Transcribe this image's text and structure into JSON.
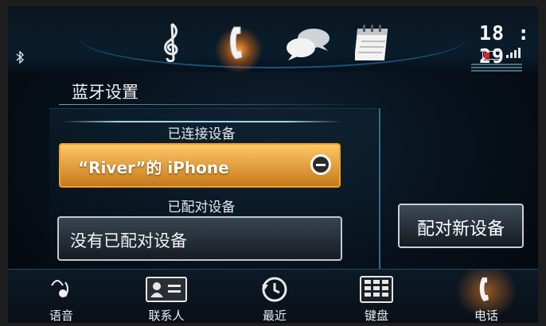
{
  "status": {
    "clock": "18 : 29",
    "bluetooth_icon": "bluetooth-icon",
    "battery_icon": "battery-icon",
    "signal_icon": "signal-icon"
  },
  "top_icons": [
    "music-note-icon",
    "phone-icon",
    "chat-bubbles-icon",
    "calendar-icon"
  ],
  "page": {
    "title": "蓝牙设置",
    "connected_section": "已连接设备",
    "connected_device": "“River”的 iPhone",
    "disconnect_icon": "minus-circle-icon",
    "paired_section": "已配对设备",
    "no_paired": "没有已配对设备",
    "pair_new": "配对新设备"
  },
  "bottom_nav": [
    {
      "label": "语音",
      "icon": "voice-icon"
    },
    {
      "label": "联系人",
      "icon": "contacts-icon"
    },
    {
      "label": "最近",
      "icon": "recent-clock-icon"
    },
    {
      "label": "键盘",
      "icon": "keypad-icon"
    },
    {
      "label": "电话",
      "icon": "phone-icon"
    }
  ],
  "colors": {
    "accent_orange": "#f0a12a",
    "accent_blue": "#2c89c6"
  }
}
